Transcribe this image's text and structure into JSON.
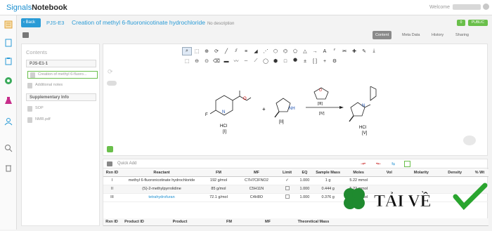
{
  "app": {
    "logo_text": "Signals",
    "logo_bold": "Notebook",
    "welcome": "Welcome"
  },
  "header": {
    "back_label": "Back",
    "breadcrumb_id": "PJS-E3",
    "title": "Creation of methyl 6-fluoronicotinate hydrochloride",
    "description": "No description",
    "badges": [
      "0",
      "PUBLIC"
    ]
  },
  "subtabs": [
    "Content",
    "Meta Data",
    "History",
    "Sharing"
  ],
  "sidebar": {
    "title": "Contents",
    "section1": "PJS-E1-1",
    "items": [
      "Creation of methyl 6-fluoro...",
      "Additional notes"
    ],
    "section2": "Supplementary Info",
    "supp_items": [
      "SOP",
      "NMR.pdf"
    ]
  },
  "reaction": {
    "labels": [
      "[I]",
      "[II]",
      "[III]",
      "[IV]",
      "[V]"
    ],
    "hcl": "HCl",
    "plus": "+",
    "atoms": {
      "F": "F",
      "N": "N",
      "NH": "NH",
      "O": "O"
    }
  },
  "table": {
    "quick_add": "Quick Add",
    "headers": [
      "Rxn ID",
      "Reactant",
      "FM",
      "MF",
      "Limit",
      "EQ",
      "Sample Mass",
      "Moles",
      "Vol",
      "Molarity",
      "Density",
      "% Wt"
    ],
    "rows": [
      {
        "id": "I",
        "reactant": "methyl 6-fluoronicotinate hydrochloride",
        "fm": "192 g/mol",
        "mf": "C7H7ClFNO2",
        "limit": "✓",
        "eq": "1.000",
        "mass": "1 g",
        "moles": "5.22 mmol"
      },
      {
        "id": "II",
        "reactant": "(S)-2-methylpyrrolidine",
        "fm": "85 g/mol",
        "mf": "C5H11N",
        "limit": "",
        "eq": "1.000",
        "mass": "0.444 g",
        "moles": "5.22 mmol"
      },
      {
        "id": "III",
        "reactant": "tetrahydrofuran",
        "fm": "72.1 g/mol",
        "mf": "C4H8O",
        "limit": "",
        "eq": "1.000",
        "mass": "0.376 g",
        "moles": "5.22 mmol"
      }
    ],
    "product_headers": [
      "Rxn ID",
      "Product ID",
      "Product",
      "FM",
      "MF",
      "Theoretical Mass"
    ]
  },
  "watermark": {
    "text": "TẢI VỀ"
  }
}
